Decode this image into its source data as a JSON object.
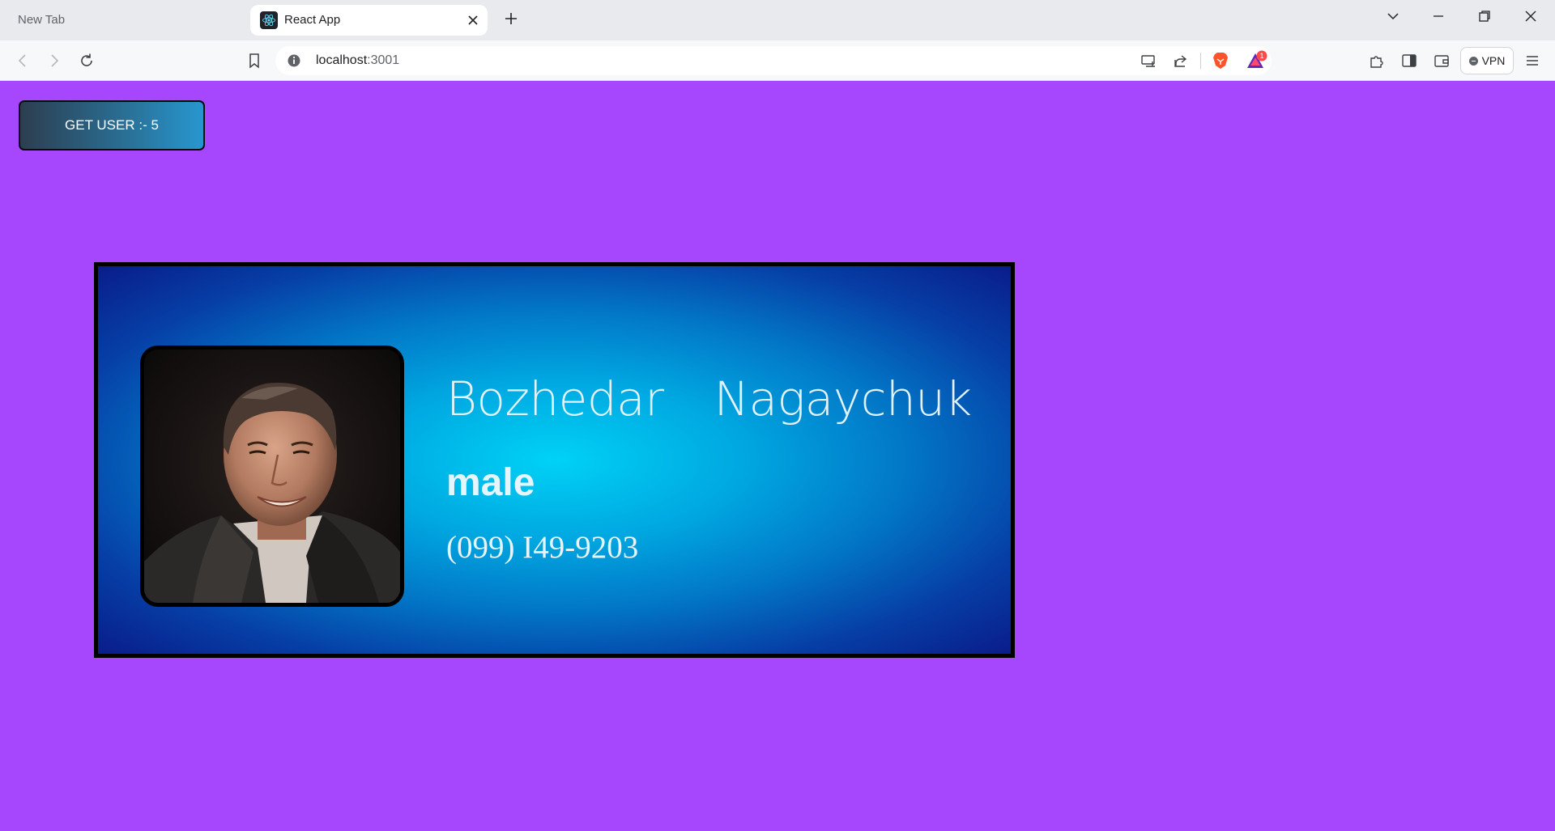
{
  "browser": {
    "tabs": [
      {
        "title": "New Tab",
        "active": false
      },
      {
        "title": "React App",
        "active": true
      }
    ],
    "address": {
      "host": "localhost",
      "port": ":3001"
    },
    "vpn_label": "VPN",
    "notification_count": "1"
  },
  "app": {
    "get_user_label": "GET USER :- 5",
    "user": {
      "first_name": "Bozhedar",
      "last_name": "Nagaychuk",
      "gender": "male",
      "phone": "(099) I49-9203"
    }
  },
  "colors": {
    "page_background": "#a646fd",
    "card_center": "#00d2f6",
    "card_edge": "#0a1c8a",
    "button_gradient_start": "#2c3e50",
    "button_gradient_end": "#2797cf"
  }
}
